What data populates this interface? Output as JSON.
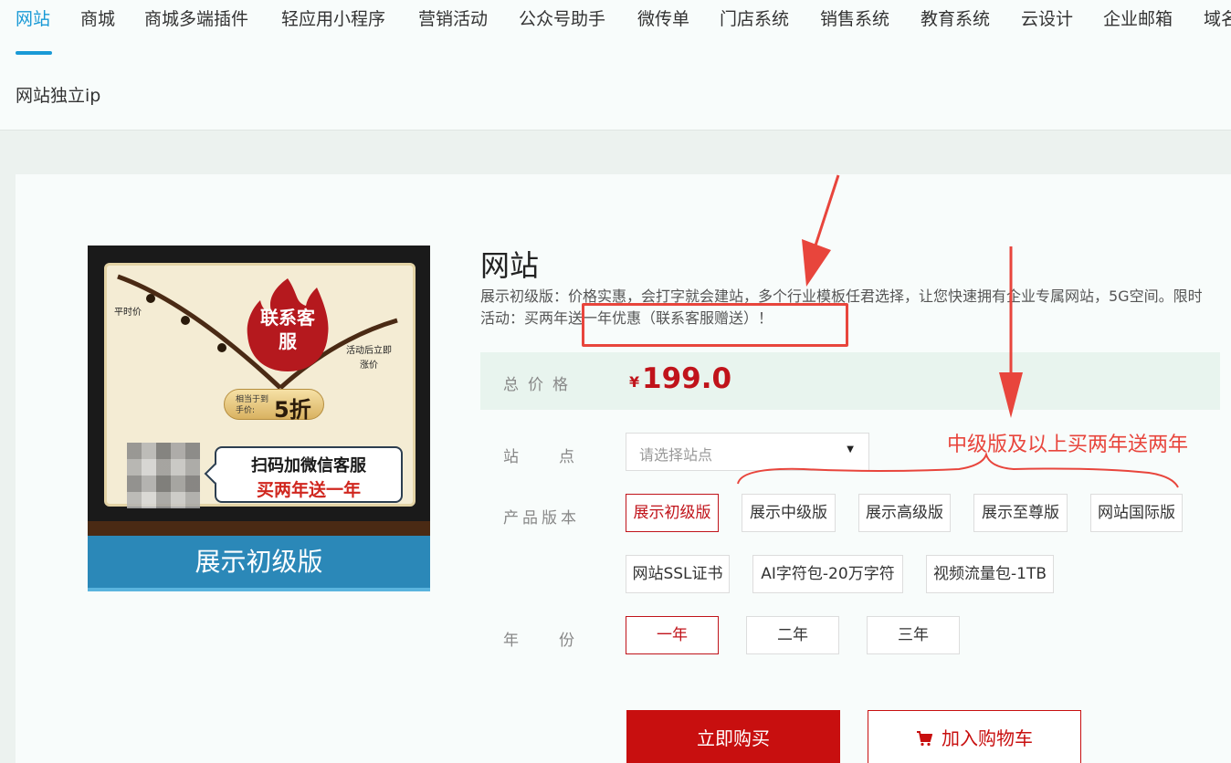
{
  "nav": {
    "items": [
      "网站",
      "商城",
      "商城多端插件",
      "轻应用小程序",
      "营销活动",
      "公众号助手",
      "微传单",
      "门店系统",
      "销售系统",
      "教育系统",
      "云设计",
      "企业邮箱",
      "域名"
    ],
    "sub_item": "网站独立ip",
    "active_color": "#1a9ad6"
  },
  "product_image": {
    "flame_text": "联系客服",
    "label_normal": "平时价",
    "label_after": "活动后立即涨价",
    "discount_small": "相当于到手价:",
    "discount_big": "5折",
    "wechat_line1": "扫码加微信客服",
    "wechat_line2": "买两年送一年",
    "ribbon": "展示初级版"
  },
  "product": {
    "title": "网站",
    "desc_part1": "展示初级版：价格实惠，会打字就会建站，多个行业模板任君选择，让您快速拥有企业专属网站，5G空间。限时活动：",
    "desc_highlight": "买两年送一年优惠（联系客服赠送）",
    "desc_end": "！"
  },
  "price": {
    "label": "总价格",
    "currency": "¥",
    "value": "199.0",
    "color": "#c0131a"
  },
  "site": {
    "label": "站点",
    "placeholder": "请选择站点"
  },
  "version": {
    "label": "产品版本",
    "options": [
      "展示初级版",
      "展示中级版",
      "展示高级版",
      "展示至尊版",
      "网站国际版",
      "网站SSL证书",
      "AI字符包-20万字符",
      "视频流量包-1TB"
    ],
    "selected": "展示初级版"
  },
  "years": {
    "label": "年份",
    "options": [
      "一年",
      "二年",
      "三年"
    ],
    "selected": "一年"
  },
  "actions": {
    "buy": "立即购买",
    "cart": "加入购物车"
  },
  "annotation": {
    "text": "中级版及以上买两年送两年",
    "color": "#e8453c"
  }
}
